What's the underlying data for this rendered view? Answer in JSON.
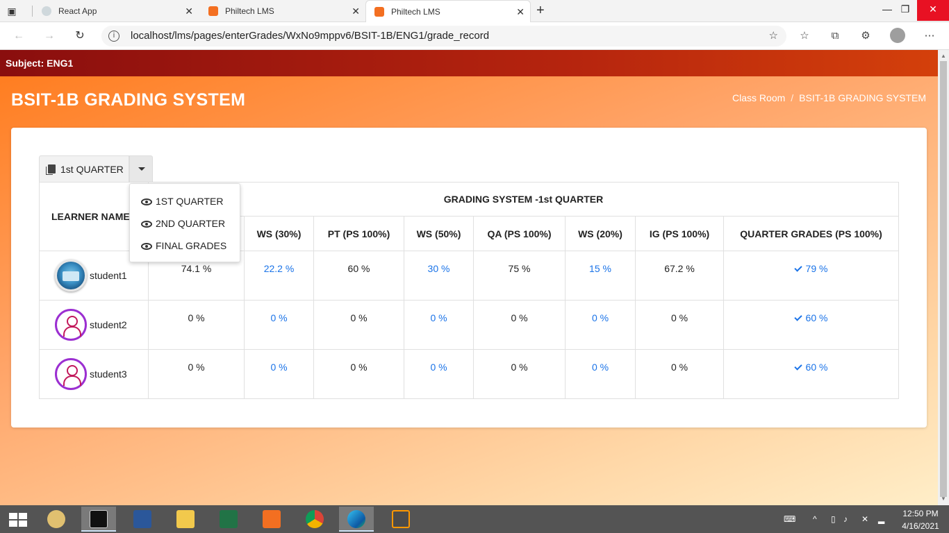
{
  "browser": {
    "tabs": [
      {
        "label": "React App",
        "icon": "react-icon",
        "active": false
      },
      {
        "label": "Philtech LMS",
        "icon": "xampp-icon",
        "active": false
      },
      {
        "label": "Philtech LMS",
        "icon": "xampp-icon",
        "active": true
      }
    ],
    "url": "localhost/lms/pages/enterGrades/WxNo9mppv6/BSIT-1B/ENG1/grade_record"
  },
  "page": {
    "subject_bar": "Subject: ENG1",
    "title": "BSIT-1B GRADING SYSTEM",
    "breadcrumb": [
      "Class Room",
      "BSIT-1B GRADING SYSTEM"
    ],
    "breadcrumb_sep": "/"
  },
  "quarter_selector": {
    "selected": "1st QUARTER",
    "options": [
      "1ST QUARTER",
      "2ND QUARTER",
      "FINAL GRADES"
    ]
  },
  "table": {
    "group_header": "GRADING SYSTEM -1st QUARTER",
    "columns": [
      "LEARNER NAMES",
      "",
      "WS (30%)",
      "PT (PS 100%)",
      "WS (50%)",
      "QA (PS 100%)",
      "WS (20%)",
      "IG (PS 100%)",
      "QUARTER GRADES (PS 100%)"
    ],
    "rows": [
      {
        "name": "student1",
        "avatar": "photo",
        "values": [
          "74.1 %",
          "22.2 %",
          "60 %",
          "30 %",
          "75 %",
          "15 %",
          "67.2 %"
        ],
        "grade": "79 %"
      },
      {
        "name": "student2",
        "avatar": "generic",
        "values": [
          "0 %",
          "0 %",
          "0 %",
          "0 %",
          "0 %",
          "0 %",
          "0 %"
        ],
        "grade": "60 %"
      },
      {
        "name": "student3",
        "avatar": "generic",
        "values": [
          "0 %",
          "0 %",
          "0 %",
          "0 %",
          "0 %",
          "0 %",
          "0 %"
        ],
        "grade": "60 %"
      }
    ]
  },
  "taskbar": {
    "time": "12:50 PM",
    "date": "4/16/2021"
  },
  "colors": {
    "accent_blue": "#1a73e8",
    "subject_bar": "#8a0e0e",
    "page_gradient_start": "#ff7a1a"
  }
}
